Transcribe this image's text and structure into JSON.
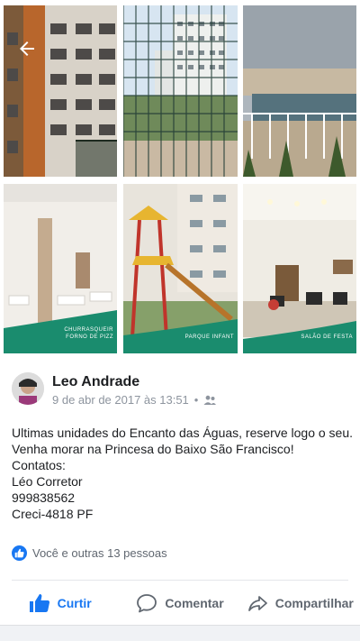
{
  "gallery": {
    "captions": [
      {
        "line1": "CHURRASQUEIR",
        "line2": "FORNO DE PIZZ"
      },
      {
        "line1": "PARQUE INFANT",
        "line2": ""
      },
      {
        "line1": "SALÃO DE FESTA",
        "line2": ""
      }
    ]
  },
  "post": {
    "author": "Leo Andrade",
    "timestamp": "9 de abr de 2017 às 13:51",
    "separator": "•",
    "privacy_icon": "friends-icon",
    "body_lines": [
      "Ultimas unidades do Encanto das Águas, reserve logo o seu.",
      "Venha morar na Princesa do Baixo São Francisco!",
      "Contatos:",
      "Léo Corretor",
      "999838562",
      "Creci-4818 PF"
    ],
    "reactions_text": "Você e outras 13 pessoas"
  },
  "actions": {
    "like_label": "Curtir",
    "comment_label": "Comentar",
    "share_label": "Compartilhar"
  },
  "colors": {
    "accent": "#1877f2",
    "caption_bg": "#1a8c6e"
  }
}
